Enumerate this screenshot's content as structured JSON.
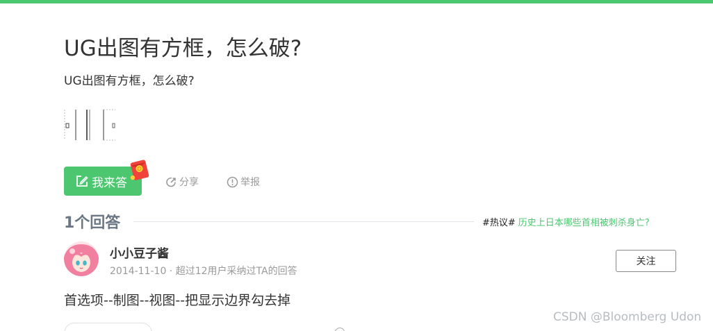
{
  "question": {
    "title": "UG出图有方框，怎么破?",
    "description": "UG出图有方框，怎么破?"
  },
  "actions": {
    "answer_label": "我来答",
    "share_label": "分享",
    "report_label": "举报"
  },
  "answers_section": {
    "count_label": "1个回答",
    "hot_tag": "#热议#",
    "hot_link": "历史上日本哪些首相被刺杀身亡?"
  },
  "answer": {
    "username": "小小豆子酱",
    "meta": "2014-11-10 · 超过12用户采纳过TA的回答",
    "follow_label": "关注",
    "text": "首选项--制图--视图--把显示边界勾去掉"
  },
  "watermark": "CSDN @Bloomberg Udon",
  "colors": {
    "brand_green": "#4cc770",
    "muted_text": "#999999",
    "heading_gray": "#6b7785"
  },
  "icons": {
    "answer": "edit-icon",
    "share": "share-icon",
    "report": "report-icon",
    "badge": "red-envelope-icon"
  }
}
